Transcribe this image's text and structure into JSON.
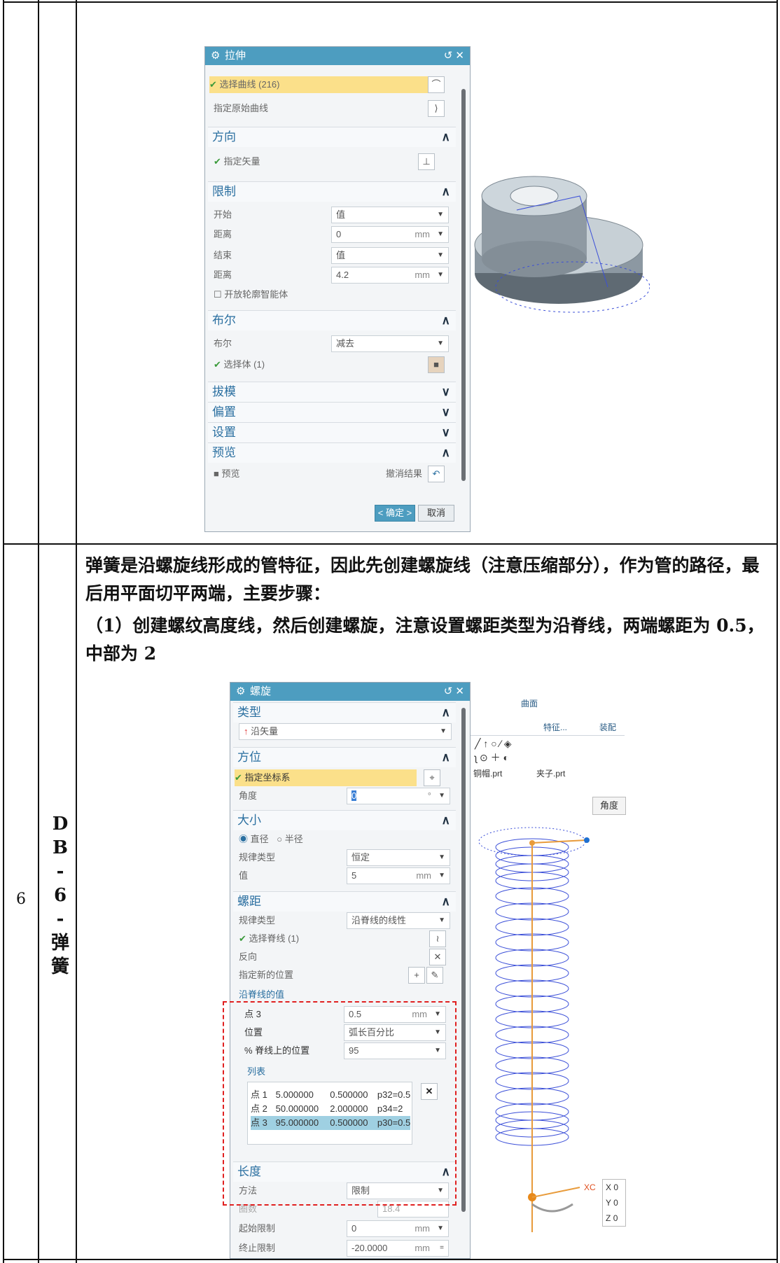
{
  "row6": {
    "number": "6",
    "name_chars": [
      "D",
      "B",
      "-",
      "6",
      "-",
      "弹",
      "簧"
    ],
    "paragraph1": "弹簧是沿螺旋线形成的管特征，因此先创建螺旋线（注意压缩部分），作为管的路径，最后用平面切平两端，主要步骤：",
    "paragraph2": "（1）创建螺纹高度线，然后创建螺旋，注意设置螺距类型为沿脊线，两端螺距为 0.5，中部为 2"
  },
  "extrude_dialog": {
    "title": "拉伸",
    "select_curve": "选择曲线 (216)",
    "specify_origin_curve": "指定原始曲线",
    "direction": {
      "title": "方向",
      "specify_vector": "指定矢量"
    },
    "limits": {
      "title": "限制",
      "start_label": "开始",
      "start_value": "值",
      "distance_label": "距离",
      "distance_value": "0",
      "distance_unit": "mm",
      "end_label": "结束",
      "end_value": "值",
      "distance2_label": "距离",
      "distance2_value": "4.2",
      "distance2_unit": "mm",
      "open_profile": "开放轮廓智能体"
    },
    "boolean": {
      "title": "布尔",
      "label": "布尔",
      "value": "减去",
      "select_body": "选择体 (1)"
    },
    "draft": "拔模",
    "offset": "偏置",
    "settings": "设置",
    "preview": {
      "title": "预览",
      "checkbox": "预览",
      "undo": "撤消结果"
    },
    "ok": "< 确定 >",
    "cancel": "取消"
  },
  "helix_dialog": {
    "title": "螺旋",
    "type": {
      "title": "类型",
      "value": "沿矢量"
    },
    "orientation": {
      "title": "方位",
      "specify_csys": "指定坐标系",
      "angle_label": "角度",
      "angle_value": "0",
      "angle_unit": "°"
    },
    "size": {
      "title": "大小",
      "diameter": "直径",
      "radius": "半径",
      "law_label": "规律类型",
      "law_value": "恒定",
      "value_label": "值",
      "value": "5",
      "unit": "mm"
    },
    "pitch": {
      "title": "螺距",
      "law_label": "规律类型",
      "law_value": "沿脊线的线性",
      "select_spine": "选择脊线 (1)",
      "reverse": "反向",
      "specify_new_location": "指定新的位置",
      "along_spine_values": "沿脊线的值",
      "point_label": "点 3",
      "point_value": "0.5",
      "point_unit": "mm",
      "location_label": "位置",
      "location_value": "弧长百分比",
      "percent_label": "% 脊线上的位置",
      "percent_value": "95",
      "list_title": "列表",
      "list_rows": [
        [
          "点 1",
          "5.000000",
          "0.500000",
          "p32=0.5"
        ],
        [
          "点 2",
          "50.000000",
          "2.000000",
          "p34=2"
        ],
        [
          "点 3",
          "95.000000",
          "0.500000",
          "p30=0.5"
        ]
      ]
    },
    "length": {
      "title": "长度",
      "method_label": "方法",
      "method_value": "限制",
      "turns_label": "圈数",
      "turns_value": "18.4",
      "start_label": "起始限制",
      "start_value": "0",
      "start_unit": "mm",
      "end_label": "终止限制",
      "end_value": "-20.0000",
      "end_unit": "mm"
    }
  },
  "cad_side": {
    "surface_label": "曲面",
    "feature_label": "特征...",
    "assembly_label": "装配",
    "tab1": "铜帽.prt",
    "tab2": "夹子.prt",
    "angle_tag": "角度",
    "xc_label": "XC",
    "coords": [
      [
        "X",
        "0"
      ],
      [
        "Y",
        "0"
      ],
      [
        "Z",
        "0"
      ]
    ]
  },
  "colors": {
    "accent": "#4d9dc0",
    "highlight": "#fbe08a",
    "dash": "#e02020",
    "helix": "#3b4fd8"
  }
}
